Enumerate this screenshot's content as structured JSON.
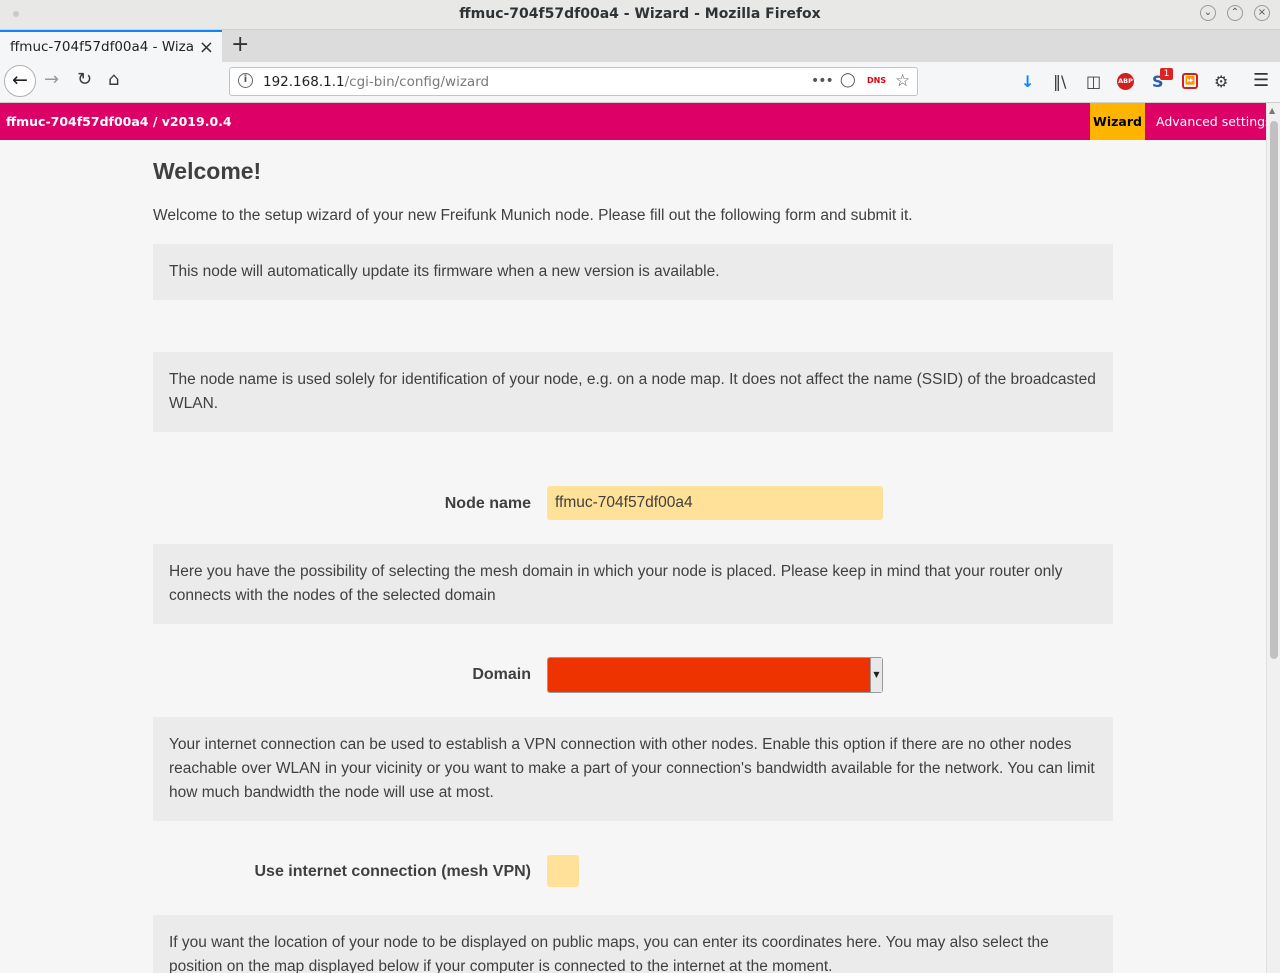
{
  "window": {
    "title": "ffmuc-704f57df00a4 - Wizard - Mozilla Firefox",
    "controls": {
      "minimize": "⌄",
      "maximize": "⌃",
      "close": "×"
    }
  },
  "tab": {
    "title": "ffmuc-704f57df00a4 - Wizard",
    "close": "×",
    "new_tab": "+"
  },
  "navigation": {
    "url_host": "192.168.1.1",
    "url_path": "/cgi-bin/config/wizard",
    "page_actions": "•••",
    "dns_label": "DNS",
    "extension_badge": "1",
    "abp_label": "ABP"
  },
  "header": {
    "brand": "ffmuc-704f57df00a4 / v2019.0.4",
    "nav": {
      "wizard": "Wizard",
      "advanced": "Advanced settings"
    },
    "colors": {
      "header_bg": "#dc0067",
      "active_tab_bg": "#ffb400"
    }
  },
  "wizard": {
    "heading": "Welcome!",
    "intro": "Welcome to the setup wizard of your new Freifunk Munich node. Please fill out the following form and submit it.",
    "autoupdate_note": "This node will automatically update its firmware when a new version is available.",
    "hostname_help": "The node name is used solely for identification of your node, e.g. on a node map. It does not affect the name (SSID) of the broadcasted WLAN.",
    "hostname_label": "Node name",
    "hostname_value": "ffmuc-704f57df00a4",
    "domain_help": "Here you have the possibility of selecting the mesh domain in which your node is placed. Please keep in mind that your router only connects with the nodes of the selected domain",
    "domain_label": "Domain",
    "domain_value": "",
    "vpn_help": "Your internet connection can be used to establish a VPN connection with other nodes. Enable this option if there are no other nodes reachable over WLAN in your vicinity or you want to make a part of your connection's bandwidth available for the network. You can limit how much bandwidth the node will use at most.",
    "vpn_label": "Use internet connection (mesh VPN)",
    "vpn_checked": false,
    "location_help": "If you want the location of your node to be displayed on public maps, you can enter its coordinates here. You may also select the position on the map displayed below if your computer is connected to the internet at the moment."
  }
}
